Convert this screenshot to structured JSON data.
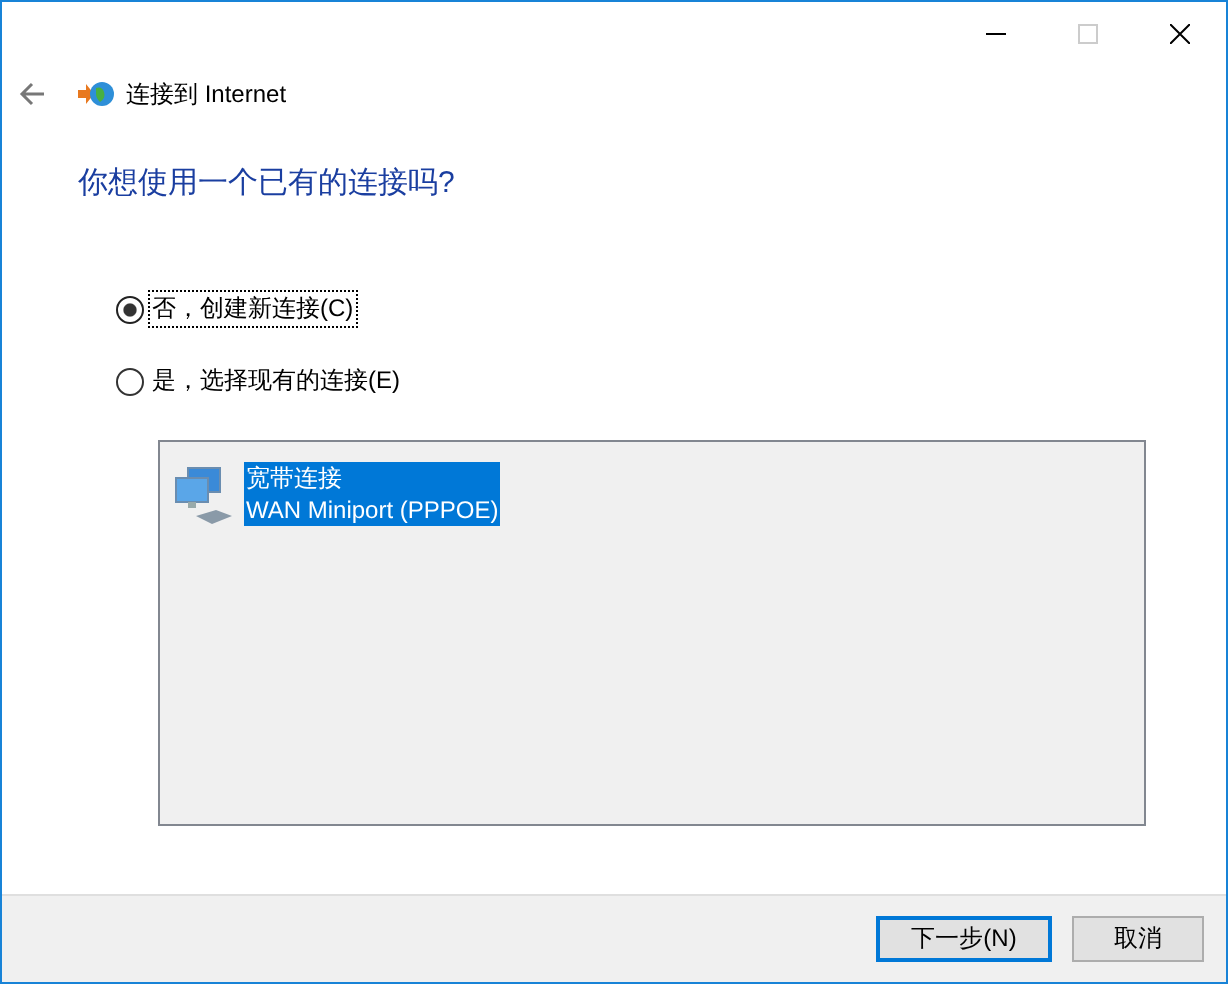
{
  "header": {
    "title": "连接到 Internet"
  },
  "heading": "你想使用一个已有的连接吗?",
  "options": [
    {
      "label": "否，创建新连接(C)",
      "selected": true
    },
    {
      "label": "是，选择现有的连接(E)",
      "selected": false
    }
  ],
  "connections": [
    {
      "name": "宽带连接",
      "device": "WAN Miniport (PPPOE)",
      "selected": true
    }
  ],
  "buttons": [
    {
      "label": "下一步(N)",
      "default": true
    },
    {
      "label": "取消",
      "default": false
    }
  ]
}
